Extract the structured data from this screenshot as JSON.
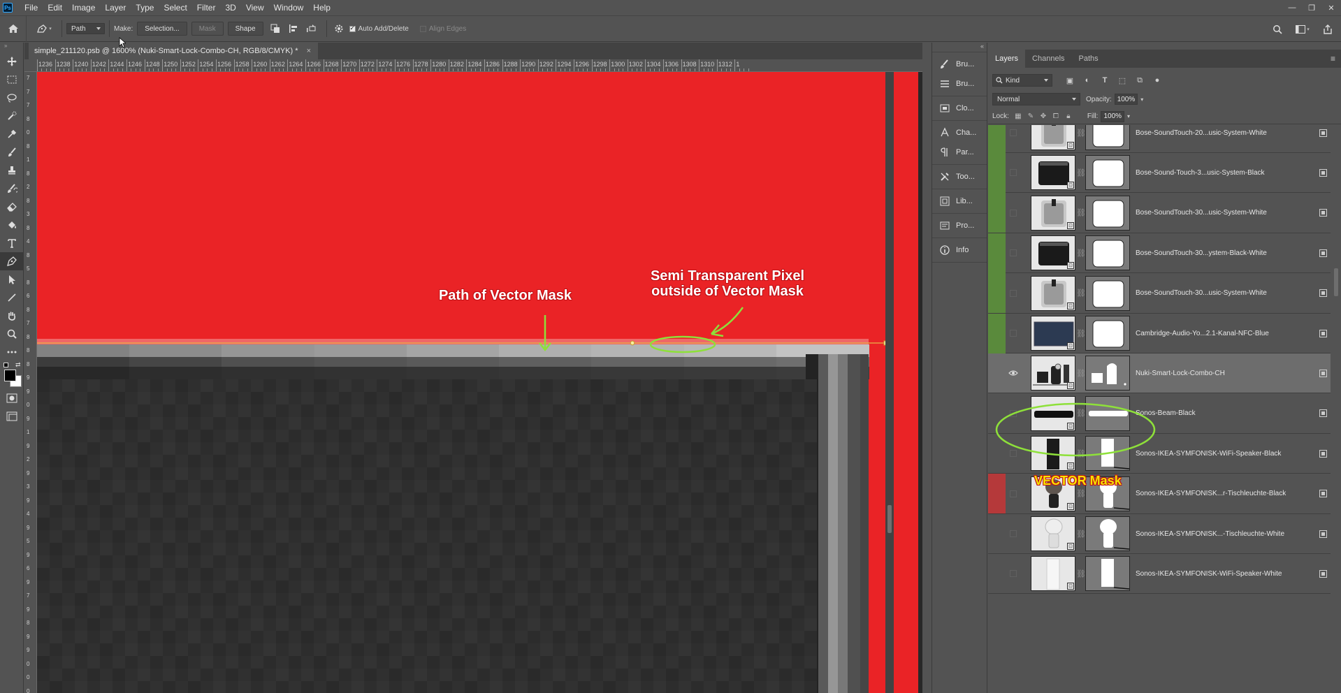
{
  "app": {
    "logo": "Ps"
  },
  "menu": [
    "File",
    "Edit",
    "Image",
    "Layer",
    "Type",
    "Select",
    "Filter",
    "3D",
    "View",
    "Window",
    "Help"
  ],
  "window_controls": [
    "—",
    "❐",
    "✕"
  ],
  "options": {
    "mode": "Path",
    "make_label": "Make:",
    "selection_button": "Selection...",
    "mask_button": "Mask",
    "shape_button": "Shape",
    "auto_add_delete": "Auto Add/Delete",
    "align_edges": "Align Edges"
  },
  "document": {
    "tab_title": "simple_211120.psb @ 1600% (Nuki-Smart-Lock-Combo-CH, RGB/8/CMYK) *",
    "close": "×"
  },
  "ruler_h": [
    "1236",
    "1238",
    "1240",
    "1242",
    "1244",
    "1246",
    "1248",
    "1250",
    "1252",
    "1254",
    "1256",
    "1258",
    "1260",
    "1262",
    "1264",
    "1266",
    "1268",
    "1270",
    "1272",
    "1274",
    "1276",
    "1278",
    "1280",
    "1282",
    "1284",
    "1286",
    "1288",
    "1290",
    "1292",
    "1294",
    "1296",
    "1298",
    "1300",
    "1302",
    "1304",
    "1306",
    "1308",
    "1310",
    "1312",
    "1"
  ],
  "annotations": {
    "path_label": "Path of Vector Mask",
    "semi_label_line1": "Semi Transparent Pixel",
    "semi_label_line2": "outside of Vector Mask",
    "vector_mask_label": "VECTOR Mask"
  },
  "dock": [
    {
      "icon": "brush-icon",
      "label": "Bru..."
    },
    {
      "icon": "brush-settings-icon",
      "label": "Bru..."
    },
    {
      "icon": "clone-source-icon",
      "label": "Clo..."
    },
    {
      "icon": "character-icon",
      "label": "Cha..."
    },
    {
      "icon": "paragraph-icon",
      "label": "Par..."
    },
    {
      "icon": "tool-presets-icon",
      "label": "Too..."
    },
    {
      "icon": "libraries-icon",
      "label": "Lib..."
    },
    {
      "icon": "properties-icon",
      "label": "Pro..."
    },
    {
      "icon": "info-icon",
      "label": "Info"
    }
  ],
  "layers_panel": {
    "tabs": [
      "Layers",
      "Channels",
      "Paths"
    ],
    "active_tab": "Layers",
    "filter_kind": "Kind",
    "blend_mode": "Normal",
    "opacity_label": "Opacity:",
    "opacity": "100%",
    "lock_label": "Lock:",
    "fill_label": "Fill:",
    "fill": "100%",
    "layers": [
      {
        "name": "Bose-SoundTouch-20...usic-System-White",
        "color": "#5a8a3c",
        "thumb": "white-speaker",
        "mask": "rounded"
      },
      {
        "name": "Bose-Sound-Touch-3...usic-System-Black",
        "color": "#5a8a3c",
        "thumb": "black-speaker",
        "mask": "rounded"
      },
      {
        "name": "Bose-SoundTouch-30...usic-System-White",
        "color": "#5a8a3c",
        "thumb": "white-speaker",
        "mask": "rounded"
      },
      {
        "name": "Bose-SoundTouch-30...ystem-Black-White",
        "color": "#5a8a3c",
        "thumb": "black-speaker",
        "mask": "rounded"
      },
      {
        "name": "Bose-SoundTouch-30...usic-System-White",
        "color": "#5a8a3c",
        "thumb": "white-speaker",
        "mask": "rounded"
      },
      {
        "name": "Cambridge-Audio-Yo...2.1-Kanal-NFC-Blue",
        "color": "#5a8a3c",
        "thumb": "blue-speaker",
        "mask": "rounded"
      },
      {
        "name": "Nuki-Smart-Lock-Combo-CH",
        "color": "",
        "thumb": "nuki",
        "mask": "nuki",
        "visible": true,
        "selected": true
      },
      {
        "name": "Sonos-Beam-Black",
        "color": "",
        "thumb": "soundbar",
        "mask": "bar"
      },
      {
        "name": "Sonos-IKEA-SYMFONISK-WiFi-Speaker-Black",
        "color": "",
        "thumb": "tall-black",
        "mask": "tall"
      },
      {
        "name": "Sonos-IKEA-SYMFONISK...r-Tischleuchte-Black",
        "color": "#b5393a",
        "thumb": "lamp-dark",
        "mask": "lamp"
      },
      {
        "name": "Sonos-IKEA-SYMFONISK...-Tischleuchte-White",
        "color": "",
        "thumb": "lamp-light",
        "mask": "lamp"
      },
      {
        "name": "Sonos-IKEA-SYMFONISK-WiFi-Speaker-White",
        "color": "",
        "thumb": "tall-white",
        "mask": "tall"
      }
    ]
  },
  "colors": {
    "canvas_red": "#ea2326",
    "annotation_green": "#8ee03a",
    "annotation_yellow": "#f5e400",
    "annotation_outline": "#c01015"
  }
}
